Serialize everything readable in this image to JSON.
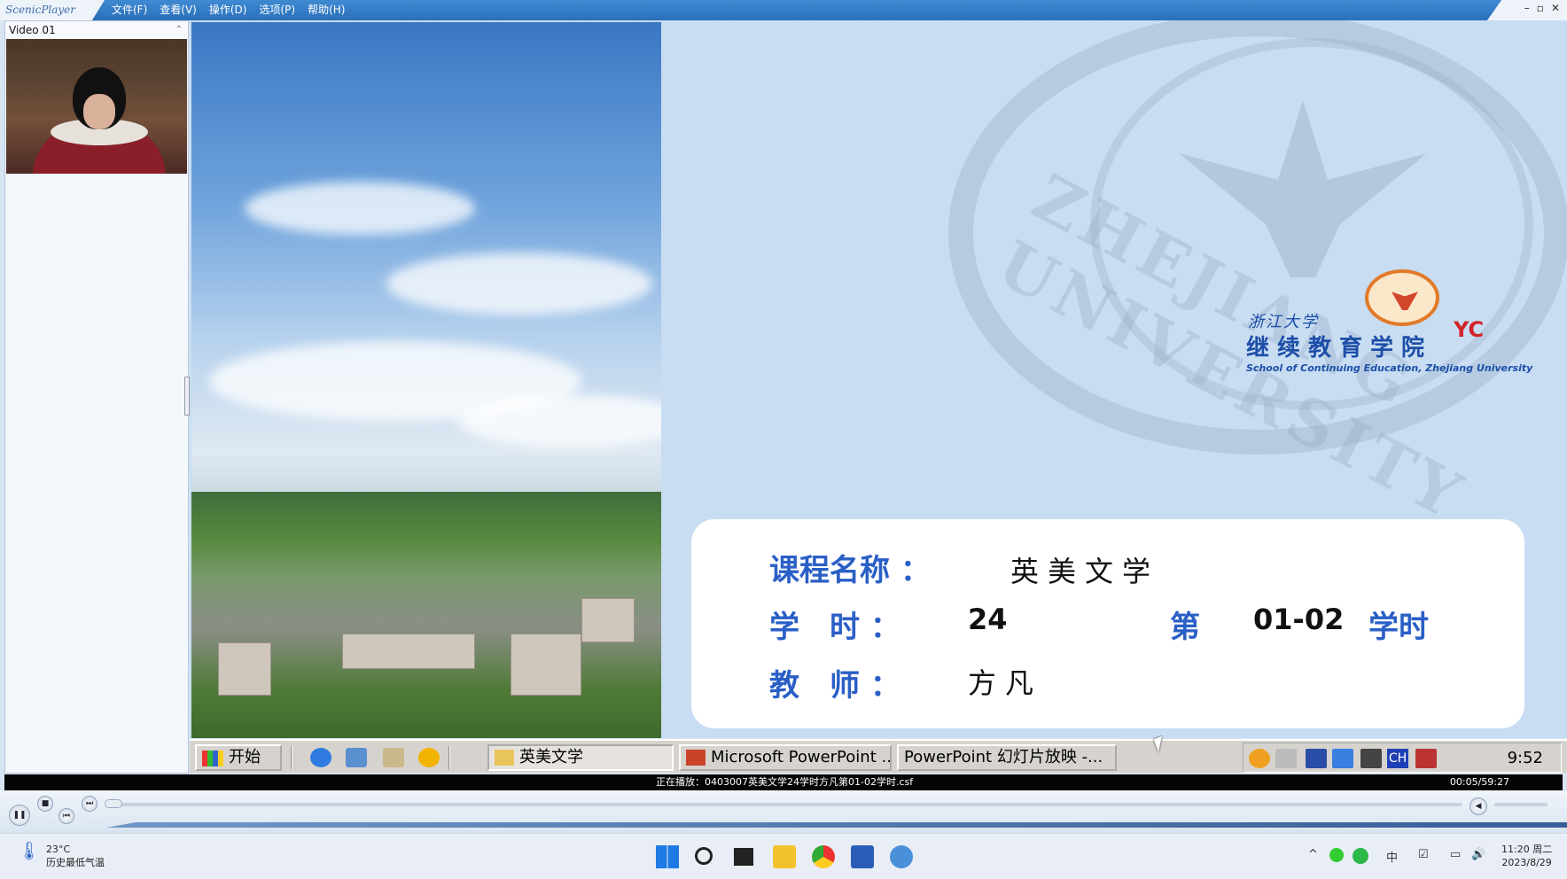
{
  "window": {
    "app_name": "ScenicPlayer",
    "menu": [
      "文件(F)",
      "查看(V)",
      "操作(D)",
      "选项(P)",
      "帮助(H)"
    ],
    "controls": [
      "–",
      "▫",
      "✕"
    ]
  },
  "video_panel": {
    "title": "Video 01"
  },
  "slide": {
    "watermark": "ZHEJIANG UNIVERSITY",
    "logo": {
      "university": "浙江大学",
      "school": "继续教育学院",
      "badge": "YC",
      "english": "School of Continuing Education, Zhejiang University"
    },
    "course_label": "课程名称 ：",
    "course_value": "英美文学",
    "hours_label": "学　时 ：",
    "hours_value": "24",
    "lesson_prefix": "第",
    "lesson_value": "01-02",
    "lesson_suffix": "学时",
    "teacher_label": "教　师 ：",
    "teacher_value": "方凡"
  },
  "inner_taskbar": {
    "start": "开始",
    "tasks": [
      "英美文学",
      "Microsoft PowerPoint ...",
      "PowerPoint 幻灯片放映 -..."
    ],
    "tray_lang": "CH",
    "clock": "9:52"
  },
  "status": {
    "now_playing": "正在播放：0403007英美文学24学时方凡第01-02学时.csf",
    "time": "00:05/59:27"
  },
  "os_taskbar": {
    "weather_temp": "23°C",
    "weather_text": "历史最低气温",
    "ime": "中",
    "time": "11:20 周二",
    "date": "2023/8/29"
  },
  "colors": {
    "accent_blue": "#2a5fc6",
    "titlebar": "#2a6fba",
    "logo_red": "#d3232a"
  }
}
